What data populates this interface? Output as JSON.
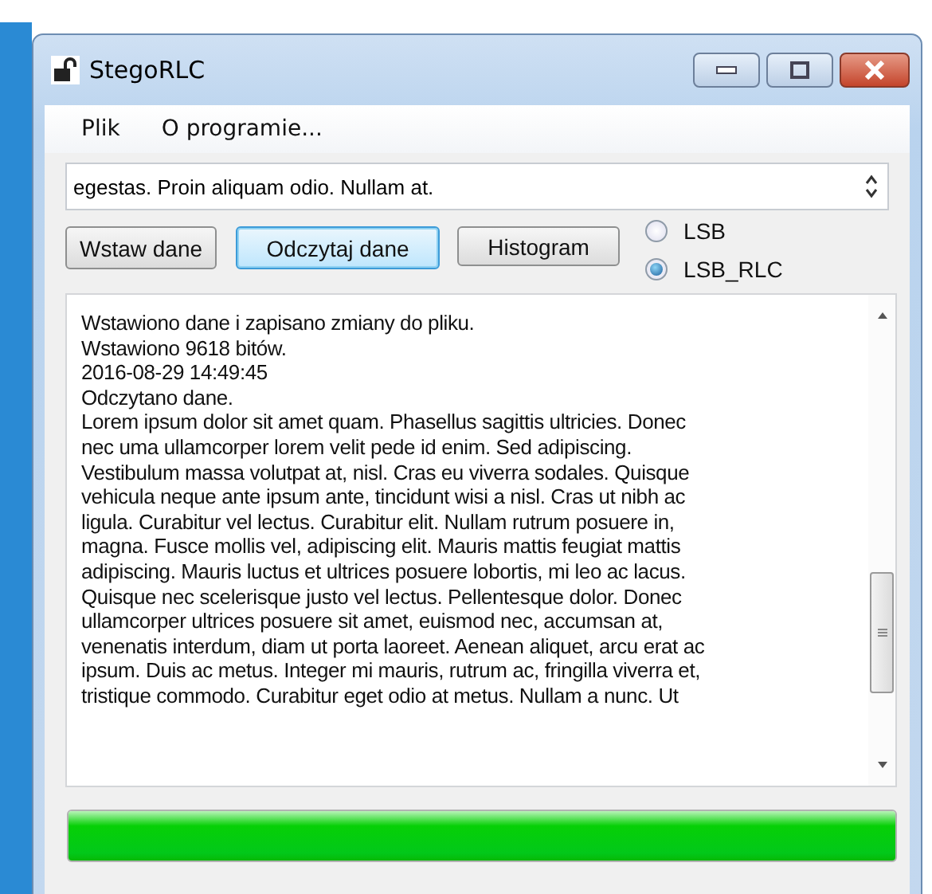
{
  "window": {
    "title": "StegoRLC"
  },
  "menu": [
    "Plik",
    "O programie..."
  ],
  "input": {
    "value": "egestas. Proin aliquam odio. Nullam at."
  },
  "buttons": [
    {
      "label": "Wstaw dane",
      "focused": false
    },
    {
      "label": "Odczytaj dane",
      "focused": true
    },
    {
      "label": "Histogram",
      "focused": false
    }
  ],
  "radios": [
    {
      "label": "LSB",
      "selected": false
    },
    {
      "label": "LSB_RLC",
      "selected": true
    }
  ],
  "log": [
    "Wstawiono dane i zapisano zmiany do pliku.",
    "Wstawiono 9618 bitów.",
    "2016-08-29 14:49:45",
    "Odczytano dane.",
    "Lorem ipsum dolor sit amet quam. Phasellus sagittis ultricies. Donec",
    "nec uma ullamcorper lorem velit pede id enim. Sed adipiscing.",
    "Vestibulum massa volutpat at, nisl. Cras eu viverra sodales. Quisque",
    "vehicula neque ante ipsum ante, tincidunt wisi a nisl. Cras ut nibh ac",
    "ligula. Curabitur vel lectus. Curabitur elit. Nullam rutrum posuere in,",
    "magna. Fusce mollis vel, adipiscing elit. Mauris mattis feugiat mattis",
    "adipiscing. Mauris luctus et ultrices posuere lobortis, mi leo ac lacus.",
    "Quisque nec scelerisque justo vel lectus. Pellentesque dolor. Donec",
    "ullamcorper ultrices posuere sit amet, euismod nec, accumsan at,",
    "venenatis interdum, diam ut porta laoreet. Aenean aliquet, arcu erat ac",
    "ipsum. Duis ac metus. Integer mi mauris, rutrum ac, fringilla viverra et,",
    "tristique commodo. Curabitur eget odio at metus. Nullam a nunc. Ut"
  ],
  "progress": {
    "level": 1
  }
}
